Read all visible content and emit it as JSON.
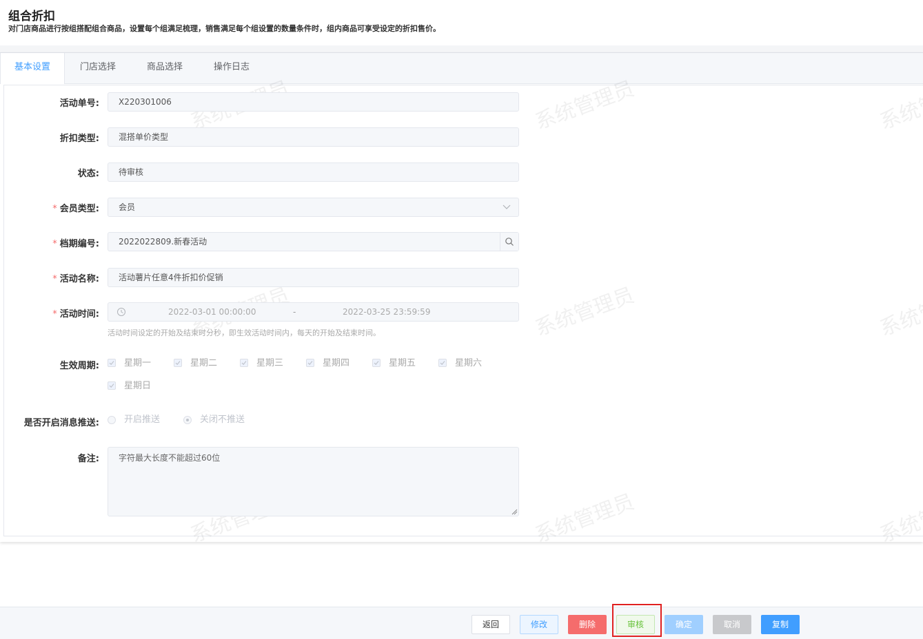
{
  "header": {
    "title": "组合折扣",
    "description": "对门店商品进行按组搭配组合商品，设置每个组满足梳理，销售满足每个组设置的数量条件时，组内商品可享受设定的折扣售价。"
  },
  "tabs": [
    {
      "label": "基本设置",
      "active": true
    },
    {
      "label": "门店选择",
      "active": false
    },
    {
      "label": "商品选择",
      "active": false
    },
    {
      "label": "操作日志",
      "active": false
    }
  ],
  "form": {
    "activity_no": {
      "label": "活动单号:",
      "value": "X220301006"
    },
    "discount_type": {
      "label": "折扣类型:",
      "value": "混搭单价类型"
    },
    "status": {
      "label": "状态:",
      "value": "待审核"
    },
    "member_type": {
      "label": "会员类型:",
      "value": "会员"
    },
    "period_no": {
      "label": "档期编号:",
      "value": "2022022809.新春活动"
    },
    "activity_name": {
      "label": "活动名称:",
      "value": "活动薯片任意4件折扣价促销"
    },
    "activity_time": {
      "label": "活动时间:",
      "start": "2022-03-01 00:00:00",
      "separator": "-",
      "end": "2022-03-25 23:59:59",
      "hint": "活动时间设定的开始及结束时分秒，即生效活动时间内，每天的开始及结束时间。"
    },
    "effective_cycle": {
      "label": "生效周期:",
      "days": [
        "星期一",
        "星期二",
        "星期三",
        "星期四",
        "星期五",
        "星期六",
        "星期日"
      ]
    },
    "push": {
      "label": "是否开启消息推送:",
      "options": [
        "开启推送",
        "关闭不推送"
      ],
      "selected": "关闭不推送"
    },
    "remark": {
      "label": "备注:",
      "placeholder": "字符最大长度不能超过60位"
    }
  },
  "watermark_text": "系统管理员",
  "buttons": {
    "back": "返回",
    "edit": "修改",
    "delete": "删除",
    "audit": "审核",
    "confirm": "确定",
    "cancel": "取消",
    "copy": "复制"
  },
  "colors": {
    "primary": "#409eff",
    "danger": "#f56c6c",
    "success": "#67c23a",
    "highlight": "#e02020"
  }
}
